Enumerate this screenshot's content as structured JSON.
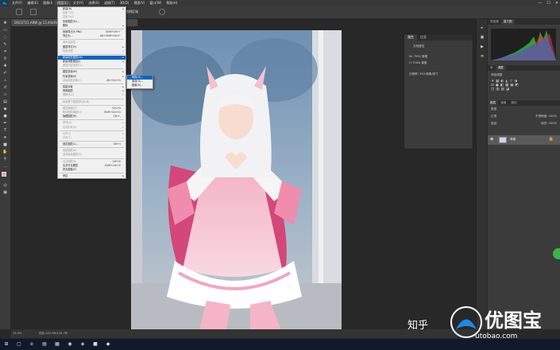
{
  "menubar": {
    "logo": "Ps",
    "items": [
      "文件(F)",
      "编辑(E)",
      "图像(I)",
      "图层(L)",
      "文字(Y)",
      "选择(S)",
      "滤镜(T)",
      "3D(D)",
      "视图(V)",
      "窗口(W)",
      "帮助(H)"
    ],
    "active_index": 3,
    "window_controls": [
      "—",
      "☐",
      "✕"
    ]
  },
  "options": {
    "label": "透明区域"
  },
  "doc_tab": {
    "title": "DSC0721.ARW @ 13.4%(RGB/8) *"
  },
  "layer_menu": {
    "rows": [
      {
        "label": "新建(N)",
        "arrow": "▸"
      },
      {
        "label": "复制 CSS",
        "dis": true
      },
      {
        "label": "复制 SVG",
        "dis": true
      },
      {
        "label": "复制图层(D)..."
      },
      {
        "label": "删除",
        "arrow": "▸"
      },
      {
        "sep": true
      },
      {
        "label": "快速导出为 PNG",
        "sc": "Shift+Ctrl+'"
      },
      {
        "label": "导出为...",
        "sc": "Alt+Shift+Ctrl+'"
      },
      {
        "sep": true
      },
      {
        "label": "重命名图层...",
        "dis": true
      },
      {
        "label": "图层样式(Y)",
        "arrow": "▸"
      },
      {
        "label": "智能滤镜",
        "arrow": "▸",
        "dis": true
      },
      {
        "sep": true
      },
      {
        "label": "新建填充图层(W)",
        "arrow": "▸",
        "hl": true
      },
      {
        "label": "新建调整图层(J)",
        "arrow": "▸"
      },
      {
        "label": "图层内容选项(O)...",
        "dis": true
      },
      {
        "sep": true
      },
      {
        "label": "图层蒙版(M)",
        "arrow": "▸"
      },
      {
        "label": "矢量蒙版(V)",
        "arrow": "▸"
      },
      {
        "label": "创建剪贴蒙版(C)",
        "sc": "Alt+Ctrl+G",
        "dis": true
      },
      {
        "sep": true
      },
      {
        "label": "智能对象",
        "arrow": "▸"
      },
      {
        "label": "视频图层",
        "arrow": "▸"
      },
      {
        "label": "栅格化(Z)",
        "arrow": "▸",
        "dis": true
      },
      {
        "sep": true
      },
      {
        "label": "新建基于图层的切片(B)",
        "dis": true
      },
      {
        "sep": true
      },
      {
        "label": "图层编组(G)",
        "sc": "Ctrl+G",
        "dis": true
      },
      {
        "label": "取消图层编组(U)",
        "sc": "Shift+Ctrl+G",
        "dis": true
      },
      {
        "label": "隐藏图层(R)",
        "sc": "Ctrl+,"
      },
      {
        "sep": true
      },
      {
        "label": "排列(A)",
        "arrow": "▸",
        "dis": true
      },
      {
        "label": "合并形状(H)",
        "arrow": "▸",
        "dis": true
      },
      {
        "sep": true
      },
      {
        "label": "对齐(I)",
        "arrow": "▸",
        "dis": true
      },
      {
        "label": "分布(T)",
        "arrow": "▸",
        "dis": true
      },
      {
        "sep": true
      },
      {
        "label": "锁定图层(L)...",
        "sc": "Ctrl+/"
      },
      {
        "sep": true
      },
      {
        "label": "链接图层(K)",
        "dis": true
      },
      {
        "label": "选择链接图层(S)",
        "dis": true
      },
      {
        "sep": true
      },
      {
        "label": "合并图层(E)",
        "sc": "Ctrl+E",
        "dis": true
      },
      {
        "label": "合并可见图层",
        "sc": "Shift+Ctrl+E"
      },
      {
        "label": "拼合图像(F)"
      },
      {
        "sep": true
      },
      {
        "label": "修边",
        "arrow": "▸"
      }
    ]
  },
  "submenu": {
    "rows": [
      {
        "label": "纯色(O)...",
        "hl": true
      },
      {
        "label": "渐变(G)..."
      },
      {
        "label": "图案(R)..."
      }
    ]
  },
  "properties": {
    "tabs": [
      "属性",
      "信息"
    ],
    "lines": [
      "文档属性",
      "W: 7952 像素",
      "H: 5304 像素",
      "分辨率: 350 像素/英寸"
    ]
  },
  "right": {
    "histo_tabs": [
      "导航器",
      "直方图"
    ],
    "adj_tabs": [
      "库",
      "调整"
    ],
    "adj_label": "添加调整",
    "layer_tabs": [
      "图层",
      "通道",
      "路径"
    ],
    "filter_label": "类型",
    "blend_label": "正常",
    "opacity_label": "不透明度: 100%",
    "lock_label": "锁定:",
    "fill_label": "填充: 100%",
    "layer_name": "背景"
  },
  "status": {
    "zoom": "13.4%",
    "doc": "文档:120.7M/120.7M"
  },
  "watermark": {
    "zhihu": "知乎",
    "brand": "优图宝",
    "url": "utobao.com"
  }
}
